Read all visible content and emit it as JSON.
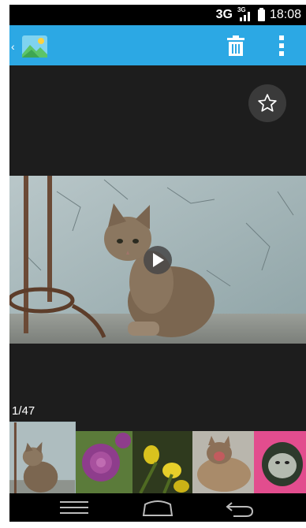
{
  "status_bar": {
    "network_label": "3G",
    "signal_type_label": "3G",
    "time": "18:08"
  },
  "action_bar": {
    "app_icon": "gallery-icon",
    "back_icon": "chevron-left-icon",
    "delete_icon": "trash-icon",
    "more_icon": "overflow-menu-icon",
    "color": "#2ca8e4"
  },
  "viewer": {
    "favorite_icon": "star-outline-icon",
    "play_icon": "play-icon",
    "media_subject": "tabby-kitten"
  },
  "filmstrip": {
    "counter": "1/47",
    "thumbnails": [
      {
        "subject": "tabby-kitten",
        "selected": true
      },
      {
        "subject": "purple-peony-flower",
        "selected": false
      },
      {
        "subject": "yellow-flowers",
        "selected": false
      },
      {
        "subject": "yawning-cat",
        "selected": false
      },
      {
        "subject": "cat-in-pink-bag",
        "selected": false
      }
    ]
  },
  "navigation_bar": {
    "icons": [
      "menu-icon",
      "home-icon",
      "back-arrow-icon"
    ]
  }
}
